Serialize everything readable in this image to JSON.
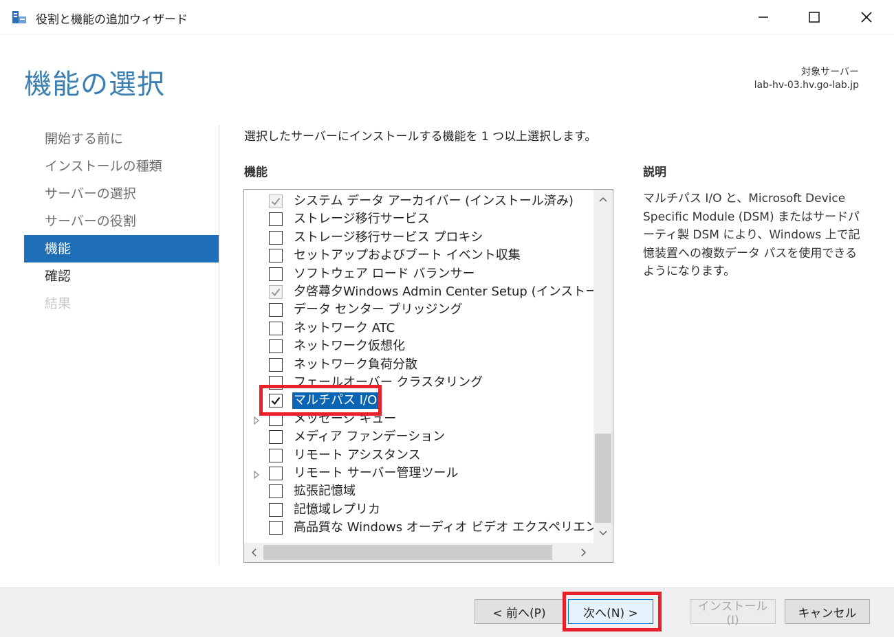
{
  "window": {
    "title": "役割と機能の追加ウィザード",
    "icon": "server-manager-icon"
  },
  "header": {
    "page_title": "機能の選択",
    "target_label": "対象サーバー",
    "target_value": "lab-hv-03.hv.go-lab.jp"
  },
  "nav": {
    "items": [
      {
        "label": "開始する前に",
        "state": "normal"
      },
      {
        "label": "インストールの種類",
        "state": "normal"
      },
      {
        "label": "サーバーの選択",
        "state": "normal"
      },
      {
        "label": "サーバーの役割",
        "state": "normal"
      },
      {
        "label": "機能",
        "state": "active"
      },
      {
        "label": "確認",
        "state": "done"
      },
      {
        "label": "結果",
        "state": "disabled"
      }
    ]
  },
  "content": {
    "instruction": "選択したサーバーにインストールする機能を 1 つ以上選択します。",
    "features_heading": "機能",
    "description_heading": "説明",
    "description_text": "マルチパス I/O と、Microsoft Device Specific Module (DSM) またはサードパーティ製 DSM により、Windows 上で記憶装置への複数データ パスを使用できるようになります。"
  },
  "features": [
    {
      "label": "システム データ アーカイバー (インストール済み)",
      "checked": true,
      "greyed": true,
      "expandable": false,
      "selected": false
    },
    {
      "label": "ストレージ移行サービス",
      "checked": false,
      "greyed": false,
      "expandable": false,
      "selected": false
    },
    {
      "label": "ストレージ移行サービス プロキシ",
      "checked": false,
      "greyed": false,
      "expandable": false,
      "selected": false
    },
    {
      "label": "セットアップおよびブート イベント収集",
      "checked": false,
      "greyed": false,
      "expandable": false,
      "selected": false
    },
    {
      "label": "ソフトウェア ロード バランサー",
      "checked": false,
      "greyed": false,
      "expandable": false,
      "selected": false
    },
    {
      "label": "夕啓蕁夕Windows Admin Center Setup (インストール済",
      "checked": true,
      "greyed": true,
      "expandable": false,
      "selected": false
    },
    {
      "label": "データ センター ブリッジング",
      "checked": false,
      "greyed": false,
      "expandable": false,
      "selected": false
    },
    {
      "label": "ネットワーク ATC",
      "checked": false,
      "greyed": false,
      "expandable": false,
      "selected": false
    },
    {
      "label": "ネットワーク仮想化",
      "checked": false,
      "greyed": false,
      "expandable": false,
      "selected": false
    },
    {
      "label": "ネットワーク負荷分散",
      "checked": false,
      "greyed": false,
      "expandable": false,
      "selected": false
    },
    {
      "label": "フェールオーバー クラスタリング",
      "checked": false,
      "greyed": false,
      "expandable": false,
      "selected": false
    },
    {
      "label": "マルチパス I/O",
      "checked": true,
      "greyed": false,
      "expandable": false,
      "selected": true
    },
    {
      "label": "メッセージ キュー",
      "checked": false,
      "greyed": false,
      "expandable": true,
      "selected": false
    },
    {
      "label": "メディア ファンデーション",
      "checked": false,
      "greyed": false,
      "expandable": false,
      "selected": false
    },
    {
      "label": "リモート アシスタンス",
      "checked": false,
      "greyed": false,
      "expandable": false,
      "selected": false
    },
    {
      "label": "リモート サーバー管理ツール",
      "checked": false,
      "greyed": false,
      "expandable": true,
      "selected": false
    },
    {
      "label": "拡張記憶域",
      "checked": false,
      "greyed": false,
      "expandable": false,
      "selected": false
    },
    {
      "label": "記憶域レプリカ",
      "checked": false,
      "greyed": false,
      "expandable": false,
      "selected": false
    },
    {
      "label": "高品質な Windows オーディオ ビデオ エクスペリエンス",
      "checked": false,
      "greyed": false,
      "expandable": false,
      "selected": false
    }
  ],
  "buttons": {
    "prev": "< 前へ(P)",
    "next": "次へ(N) >",
    "install": "インストール(I)",
    "cancel": "キャンセル"
  },
  "colors": {
    "accent": "#1e6fb7",
    "title_blue": "#3a7fb4",
    "selection": "#0a64b4",
    "highlight_red": "#e8212b"
  }
}
